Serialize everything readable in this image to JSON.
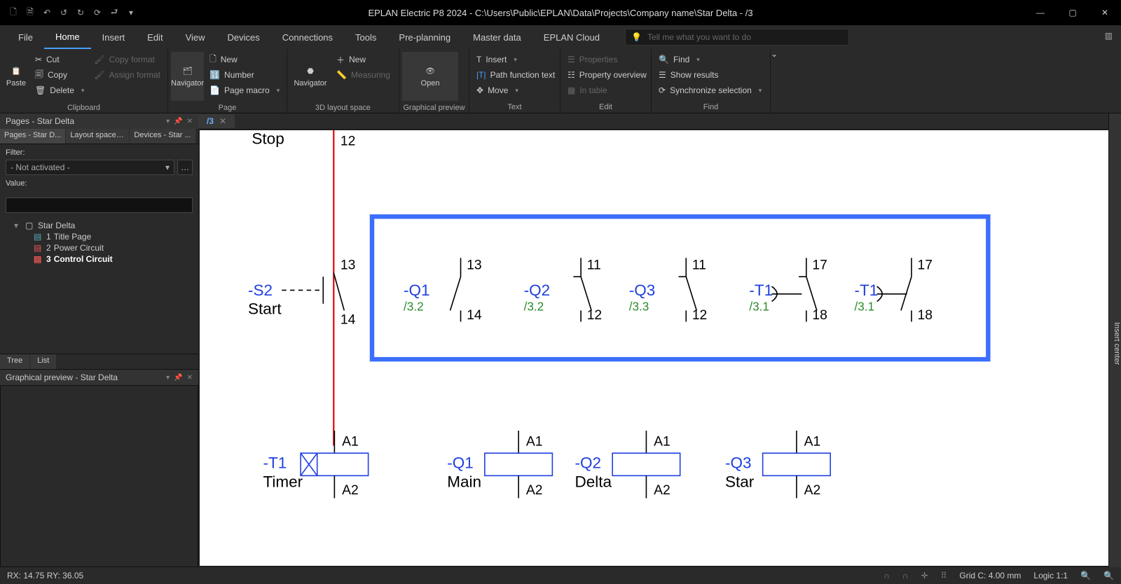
{
  "title": "EPLAN Electric P8 2024 - C:\\Users\\Public\\EPLAN\\Data\\Projects\\Company name\\Star Delta - /3",
  "menu": [
    "File",
    "Home",
    "Insert",
    "Edit",
    "View",
    "Devices",
    "Connections",
    "Tools",
    "Pre-planning",
    "Master data",
    "EPLAN Cloud"
  ],
  "menu_active": 1,
  "search_placeholder": "Tell me what you want to do",
  "ribbon": {
    "clipboard": {
      "paste": "Paste",
      "cut": "Cut",
      "copy": "Copy",
      "delete": "Delete",
      "copyfmt": "Copy format",
      "assignfmt": "Assign format",
      "label": "Clipboard"
    },
    "page": {
      "navigator": "Navigator",
      "new": "New",
      "number": "Number",
      "pagemacro": "Page macro",
      "label": "Page"
    },
    "layout3d": {
      "navigator": "Navigator",
      "new": "New",
      "measuring": "Measuring",
      "label": "3D layout space"
    },
    "preview": {
      "open": "Open",
      "label": "Graphical preview"
    },
    "text": {
      "insert": "Insert",
      "pathfn": "Path function text",
      "move": "Move",
      "label": "Text"
    },
    "edit": {
      "properties": "Properties",
      "overview": "Property overview",
      "intable": "In table",
      "label": "Edit"
    },
    "find": {
      "find": "Find",
      "results": "Show results",
      "sync": "Synchronize selection",
      "label": "Find"
    }
  },
  "pages_panel": {
    "title": "Pages - Star Delta",
    "subtabs": [
      "Pages - Star D...",
      "Layout space -...",
      "Devices - Star ..."
    ],
    "filter_label": "Filter:",
    "filter_value": "- Not activated -",
    "value_label": "Value:",
    "tree_root": "Star Delta",
    "tree_items": [
      {
        "num": "1",
        "name": "Title Page",
        "bold": false
      },
      {
        "num": "2",
        "name": "Power Circuit",
        "bold": false
      },
      {
        "num": "3",
        "name": "Control Circuit",
        "bold": true
      }
    ],
    "bottom_tabs": [
      "Tree",
      "List"
    ]
  },
  "preview_panel": {
    "title": "Graphical preview - Star Delta"
  },
  "doctab": {
    "label": "/3"
  },
  "schematic": {
    "stop": "Stop",
    "stop_pin": "12",
    "s2": {
      "tag": "-S2",
      "fn": "Start",
      "p1": "13",
      "p2": "14"
    },
    "contacts": [
      {
        "tag": "-Q1",
        "ref": "/3.2",
        "p1": "13",
        "p2": "14",
        "type": "no"
      },
      {
        "tag": "-Q2",
        "ref": "/3.2",
        "p1": "11",
        "p2": "12",
        "type": "nc"
      },
      {
        "tag": "-Q3",
        "ref": "/3.3",
        "p1": "11",
        "p2": "12",
        "type": "nc"
      },
      {
        "tag": "-T1",
        "ref": "/3.1",
        "p1": "17",
        "p2": "18",
        "type": "tnc"
      },
      {
        "tag": "-T1",
        "ref": "/3.1",
        "p1": "17",
        "p2": "18",
        "type": "tno"
      }
    ],
    "coils": [
      {
        "tag": "-T1",
        "fn": "Timer",
        "p1": "A1",
        "p2": "A2",
        "timer": true
      },
      {
        "tag": "-Q1",
        "fn": "Main",
        "p1": "A1",
        "p2": "A2",
        "timer": false
      },
      {
        "tag": "-Q2",
        "fn": "Delta",
        "p1": "A1",
        "p2": "A2",
        "timer": false
      },
      {
        "tag": "-Q3",
        "fn": "Star",
        "p1": "A1",
        "p2": "A2",
        "timer": false
      }
    ]
  },
  "status": {
    "coords": "RX: 14.75 RY: 36.05",
    "grid": "Grid C: 4.00 mm",
    "logic": "Logic 1:1"
  }
}
